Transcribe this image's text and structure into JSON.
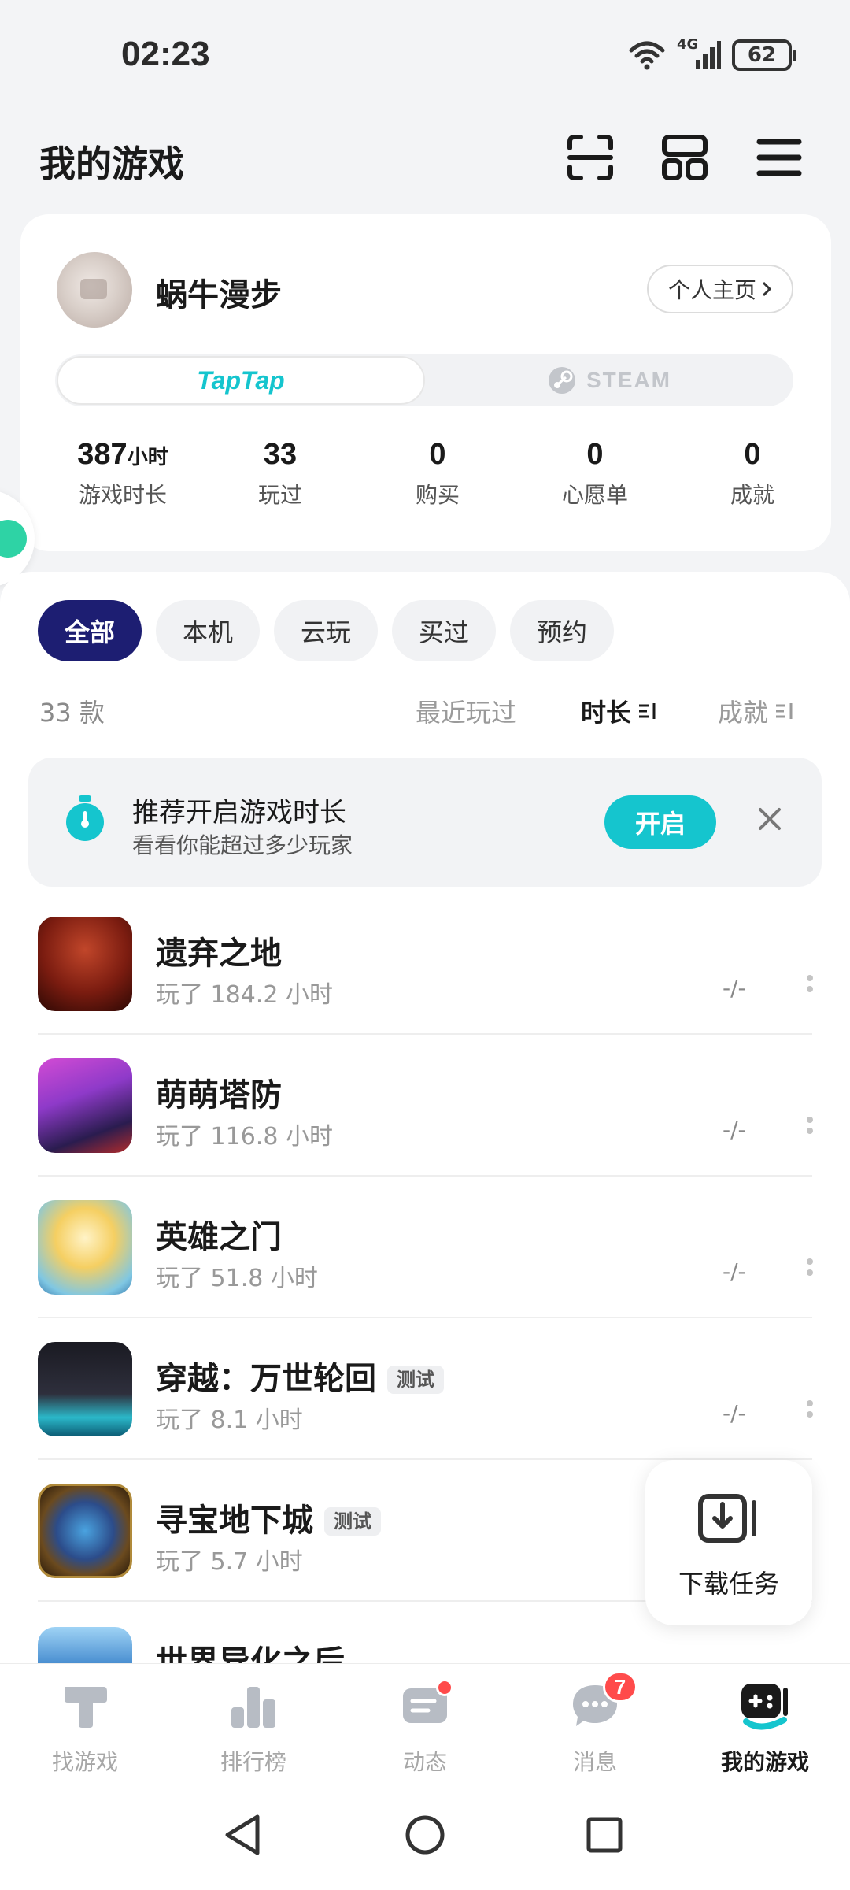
{
  "status_bar": {
    "time": "02:23",
    "network": "4G",
    "battery": "62"
  },
  "header": {
    "title": "我的游戏"
  },
  "profile": {
    "username": "蜗牛漫步",
    "home_button": "个人主页",
    "platforms": [
      "TapTap",
      "STEAM"
    ],
    "stats": [
      {
        "value": "387",
        "unit": "小时",
        "label": "游戏时长"
      },
      {
        "value": "33",
        "unit": "",
        "label": "玩过"
      },
      {
        "value": "0",
        "unit": "",
        "label": "购买"
      },
      {
        "value": "0",
        "unit": "",
        "label": "心愿单"
      },
      {
        "value": "0",
        "unit": "",
        "label": "成就"
      }
    ]
  },
  "filters": {
    "chips": [
      "全部",
      "本机",
      "云玩",
      "买过",
      "预约"
    ],
    "active": "全部"
  },
  "list_header": {
    "count": "33 款",
    "sort": [
      "最近玩过",
      "时长",
      "成就"
    ],
    "active_sort": "时长"
  },
  "promo": {
    "title": "推荐开启游戏时长",
    "subtitle": "看看你能超过多少玩家",
    "button": "开启"
  },
  "games": [
    {
      "name": "遗弃之地",
      "tag": "",
      "played": "玩了 184.2 小时",
      "score": "-/-"
    },
    {
      "name": "萌萌塔防",
      "tag": "",
      "played": "玩了 116.8 小时",
      "score": "-/-"
    },
    {
      "name": "英雄之门",
      "tag": "",
      "played": "玩了 51.8 小时",
      "score": "-/-"
    },
    {
      "name": "穿越：万世轮回",
      "tag": "测试",
      "played": "玩了 8.1 小时",
      "score": "-/-"
    },
    {
      "name": "寻宝地下城",
      "tag": "测试",
      "played": "玩了 5.7 小时",
      "score": ""
    },
    {
      "name": "世界异化之后",
      "tag": "",
      "played": "",
      "score": ""
    }
  ],
  "download": {
    "label": "下载任务"
  },
  "bottom_nav": {
    "items": [
      "找游戏",
      "排行榜",
      "动态",
      "消息",
      "我的游戏"
    ],
    "active": "我的游戏",
    "messages_badge": "7"
  },
  "colors": {
    "accent": "#15c5ce",
    "active_chip": "#1d1e72",
    "badge": "#ff4b4b"
  }
}
